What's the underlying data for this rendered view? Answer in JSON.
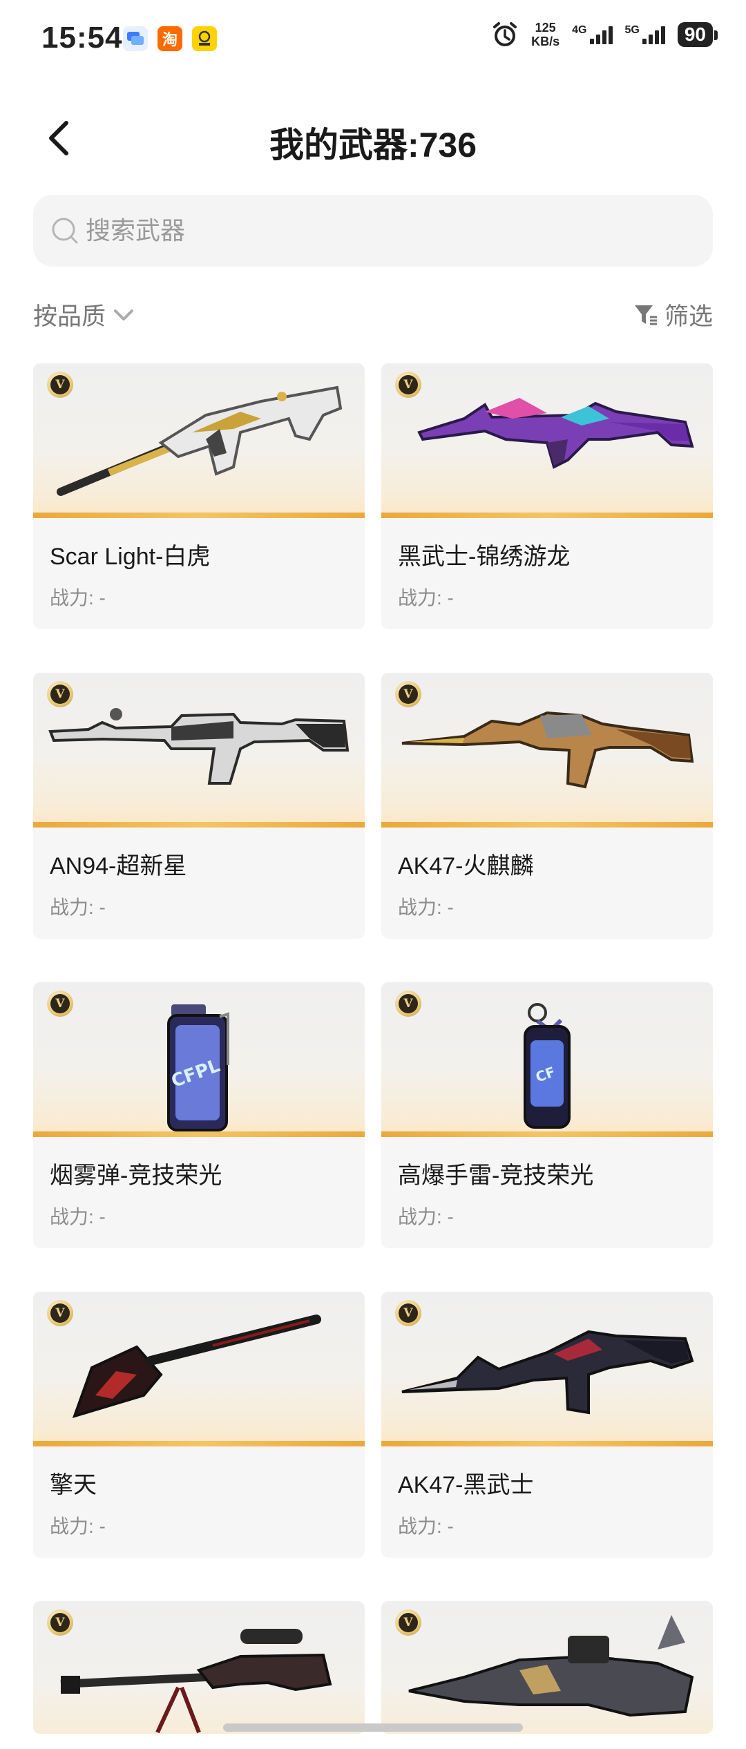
{
  "status_bar": {
    "time": "15:54",
    "apps": [
      "message-app-icon",
      "taobao-app-icon",
      "pass-app-icon"
    ],
    "taobao_label": "淘",
    "speed_value": "125",
    "speed_unit": "KB/s",
    "net1": "4G",
    "net2": "5G",
    "battery": "90"
  },
  "header": {
    "title": "我的武器:736"
  },
  "search": {
    "placeholder": "搜索武器"
  },
  "sort": {
    "label": "按品质",
    "filter_label": "筛选"
  },
  "badge_letter": "V",
  "weapons": [
    {
      "name": "Scar Light-白虎",
      "power": "战力: -",
      "icon": "rifle-white-tiger"
    },
    {
      "name": "黑武士-锦绣游龙",
      "power": "战力: -",
      "icon": "rifle-dragon"
    },
    {
      "name": "AN94-超新星",
      "power": "战力: -",
      "icon": "rifle-supernova"
    },
    {
      "name": "AK47-火麒麟",
      "power": "战力: -",
      "icon": "rifle-fire-qilin"
    },
    {
      "name": "烟雾弹-竞技荣光",
      "power": "战力: -",
      "icon": "smoke-grenade"
    },
    {
      "name": "高爆手雷-竞技荣光",
      "power": "战力: -",
      "icon": "frag-grenade"
    },
    {
      "name": "擎天",
      "power": "战力: -",
      "icon": "shovel"
    },
    {
      "name": "AK47-黑武士",
      "power": "战力: -",
      "icon": "rifle-black-warrior"
    },
    {
      "name": "",
      "power": "",
      "icon": "sniper-rifle"
    },
    {
      "name": "",
      "power": "",
      "icon": "dragon-gun"
    }
  ],
  "colors": {
    "accent_gold": "#e9a93b",
    "card_bg": "#f6f6f6",
    "muted_text": "#8c8c8c"
  }
}
